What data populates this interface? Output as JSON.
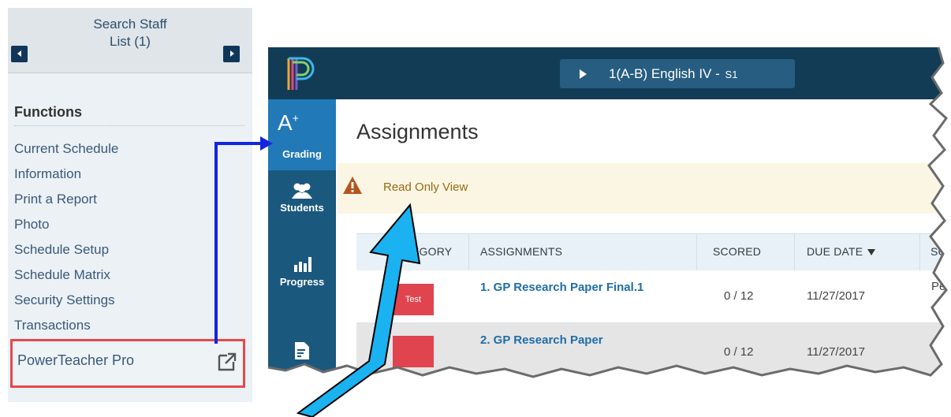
{
  "left_panel": {
    "nav_title_line1": "Search Staff",
    "nav_title_line2": "List (1)",
    "functions_title": "Functions",
    "functions": [
      "Current Schedule",
      "Information",
      "Print a Report",
      "Photo",
      "Schedule Setup",
      "Schedule Matrix",
      "Security Settings",
      "Transactions"
    ],
    "ptp_link": "PowerTeacher Pro"
  },
  "app": {
    "class_selector": "1(A-B) English IV",
    "class_separator": "-",
    "class_term": "S1",
    "sidebar": {
      "grading": "Grading",
      "students": "Students",
      "progress": "Progress"
    },
    "page_title": "Assignments",
    "alert": "Read Only View",
    "columns": {
      "category": "EGORY",
      "assignments": "ASSIGNMENTS",
      "scored": "SCORED",
      "due_date": "DUE DATE",
      "score_type": "SC"
    },
    "rows": [
      {
        "category": "Test",
        "name": "1. GP Research Paper Final.1",
        "scored": "0 / 12",
        "due": "11/27/2017",
        "extra": "Pe"
      },
      {
        "category": "",
        "name": "2. GP Research Paper",
        "scored": "0 / 12",
        "due": "11/27/2017",
        "extra": ""
      }
    ]
  },
  "colors": {
    "topbar": "#123c56",
    "sidebar": "#1b587e",
    "sidebar_active": "#2279b8",
    "alert_bg": "#fbf5e3",
    "test_badge": "#e0444f",
    "highlight_box": "#e8474c",
    "connector_arrow": "#1226e0",
    "callout_arrow": "#1ab2f0"
  }
}
